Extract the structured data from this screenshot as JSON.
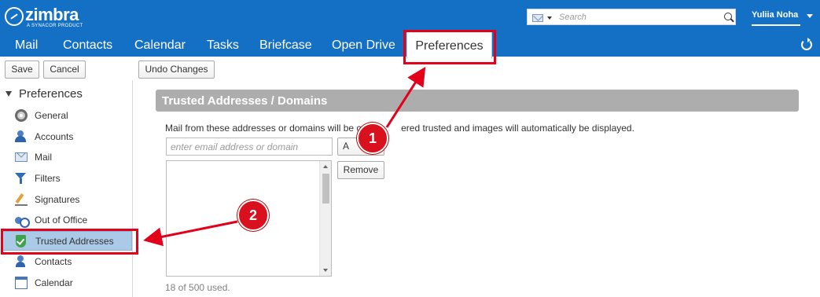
{
  "header": {
    "logo_word": "zimbra",
    "logo_subtitle": "A SYNACOR PRODUCT",
    "search_placeholder": "Search",
    "search_type_icon": "envelope-icon",
    "user_name": "Yuliia Noha"
  },
  "tabs": [
    {
      "label": "Mail"
    },
    {
      "label": "Contacts"
    },
    {
      "label": "Calendar"
    },
    {
      "label": "Tasks"
    },
    {
      "label": "Briefcase"
    },
    {
      "label": "Open Drive"
    },
    {
      "label": "Preferences",
      "active": true
    }
  ],
  "toolbar": {
    "save_label": "Save",
    "cancel_label": "Cancel",
    "undo_label": "Undo Changes"
  },
  "sidebar": {
    "heading": "Preferences",
    "items": [
      {
        "label": "General",
        "icon": "gear-icon"
      },
      {
        "label": "Accounts",
        "icon": "accounts-icon"
      },
      {
        "label": "Mail",
        "icon": "mail-icon"
      },
      {
        "label": "Filters",
        "icon": "filter-icon"
      },
      {
        "label": "Signatures",
        "icon": "signature-icon"
      },
      {
        "label": "Out of Office",
        "icon": "out-of-office-icon"
      },
      {
        "label": "Trusted Addresses",
        "icon": "shield-icon",
        "selected": true
      },
      {
        "label": "Contacts",
        "icon": "contacts-icon"
      },
      {
        "label": "Calendar",
        "icon": "calendar-icon"
      }
    ]
  },
  "main": {
    "section_title": "Trusted Addresses / Domains",
    "description_start": "Mail from these addresses or domains will be co",
    "description_end": "ered trusted and images will automatically be displayed.",
    "address_placeholder": "enter email address or domain",
    "add_label": "A",
    "remove_label": "Remove",
    "used_text": "18 of 500 used."
  },
  "annotations": {
    "callout_1": "1",
    "callout_2": "2",
    "color": "#e2001a"
  },
  "colors": {
    "header_bg": "#1470c4",
    "selected_item_bg": "#abcae7",
    "section_header_bg": "#adadad"
  }
}
